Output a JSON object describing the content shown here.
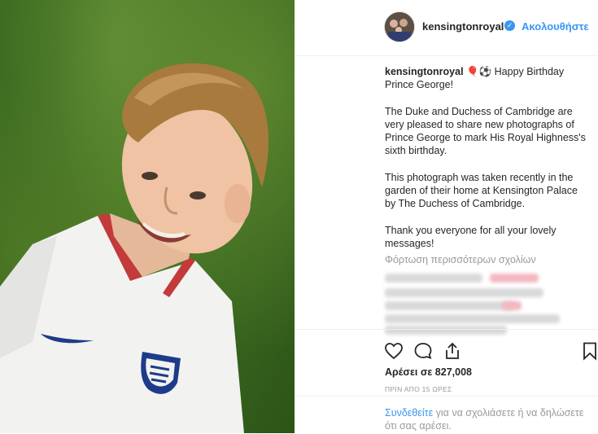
{
  "post": {
    "username": "kensingtonroyal",
    "follow_label": "Ακολουθήστε",
    "caption_emojis": "🎈⚽",
    "caption_first_line": " Happy Birthday Prince George!",
    "caption_paragraphs": [
      "The Duke and Duchess of Cambridge are very pleased to share new photographs of Prince George to mark His Royal Highness's sixth birthday.",
      "This photograph was taken recently in the garden of their home at Kensington Palace by The Duchess of Cambridge.",
      "Thank you everyone for all your lovely messages!"
    ],
    "load_more_label": "Φόρτωση περισσότερων σχολίων",
    "likes_text": "Αρέσει σε 827,008",
    "timestamp": "ΠΡΙΝ ΑΠΟ 15 ΩΡΕΣ",
    "login_link": "Συνδεθείτε",
    "login_text": " για να σχολιάσετε ή να δηλώσετε ότι σας αρέσει."
  },
  "colors": {
    "link": "#3897f0",
    "muted": "#999999",
    "text": "#262626"
  },
  "icons": [
    "verified-badge-icon",
    "heart-icon",
    "comment-icon",
    "share-icon",
    "bookmark-icon"
  ]
}
